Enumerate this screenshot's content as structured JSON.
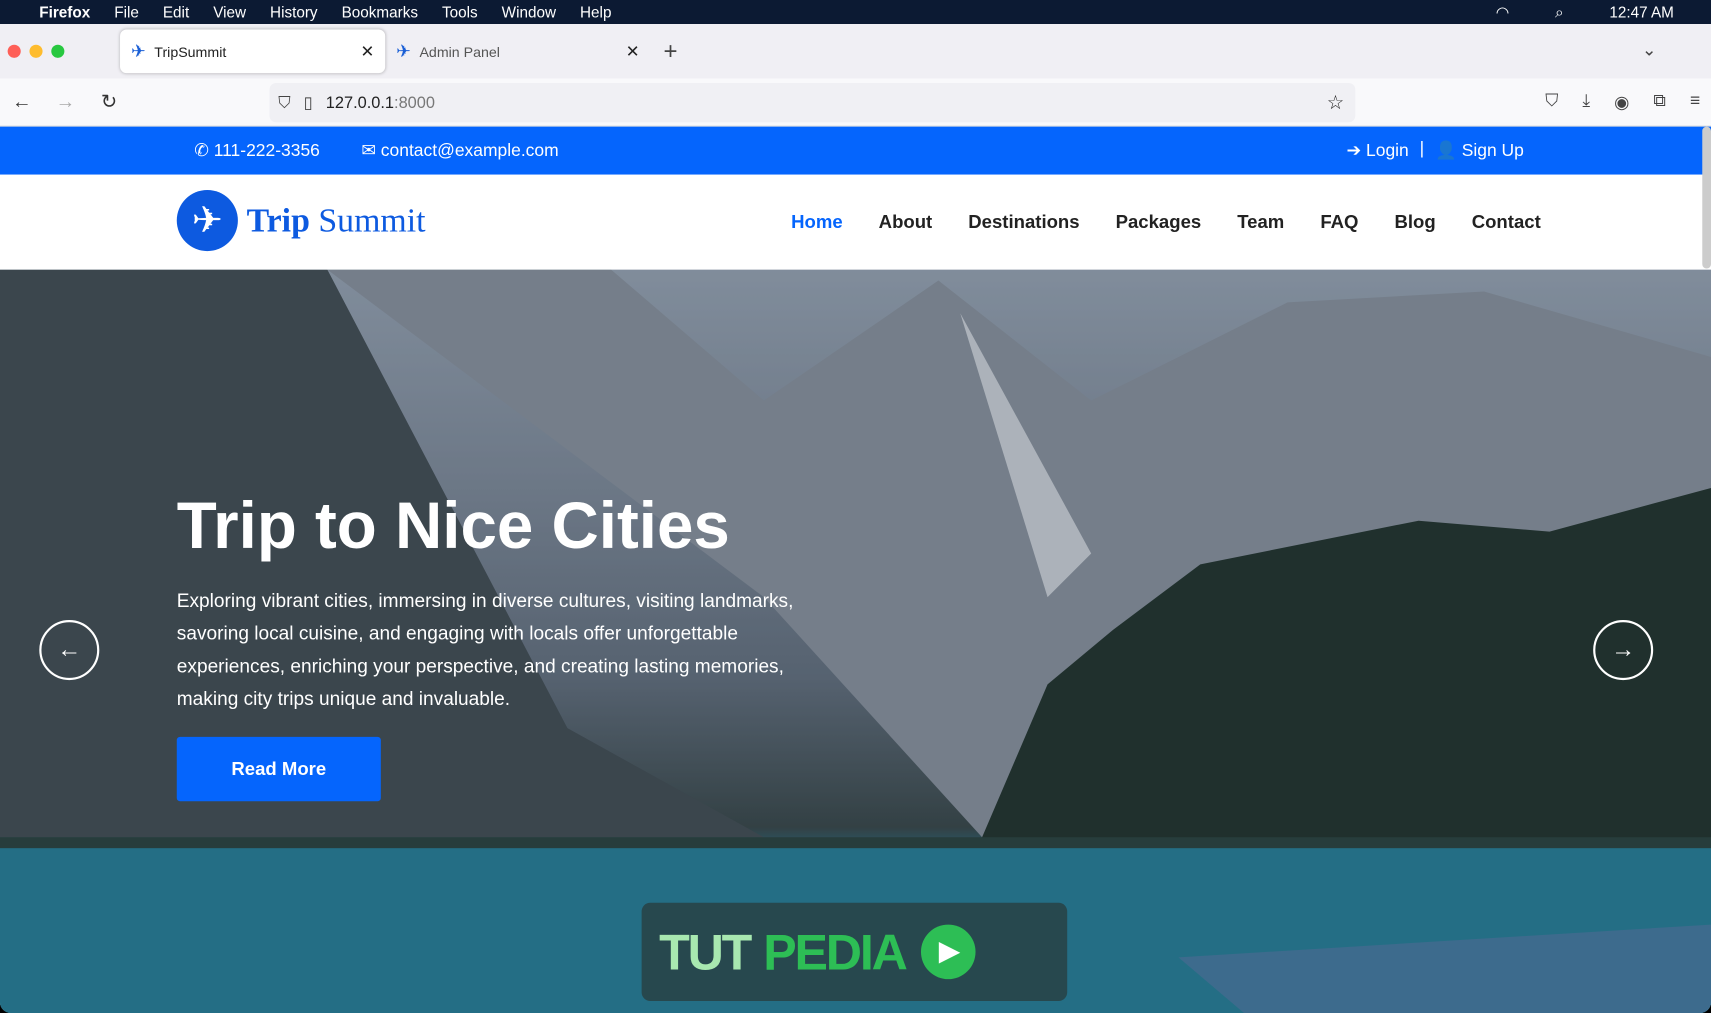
{
  "menubar": {
    "app": "Firefox",
    "items": [
      "File",
      "Edit",
      "View",
      "History",
      "Bookmarks",
      "Tools",
      "Window",
      "Help"
    ],
    "clock": "12:47 AM"
  },
  "tabs": [
    {
      "label": "TripSummit",
      "active": true
    },
    {
      "label": "Admin Panel",
      "active": false
    }
  ],
  "address": {
    "host": "127.0.0.1",
    "port": ":8000"
  },
  "topbar": {
    "phone": "111-222-3356",
    "email": "contact@example.com",
    "login": "Login",
    "separator": "|",
    "signup": "Sign Up",
    "color": "#0565fd"
  },
  "site": {
    "logo_bold": "Trip",
    "logo_rest": "Summit",
    "nav": [
      "Home",
      "About",
      "Destinations",
      "Packages",
      "Team",
      "FAQ",
      "Blog",
      "Contact"
    ],
    "active": "Home"
  },
  "hero": {
    "title": "Trip to Nice Cities",
    "text": "Exploring vibrant cities, immersing in diverse cultures, visiting landmarks, savoring local cuisine, and engaging with locals offer unforgettable experiences, enriching your perspective, and creating lasting memories, making city trips unique and invaluable.",
    "button": "Read More"
  },
  "watermark": {
    "part1": "TUT",
    "part2": "PEDIA"
  }
}
